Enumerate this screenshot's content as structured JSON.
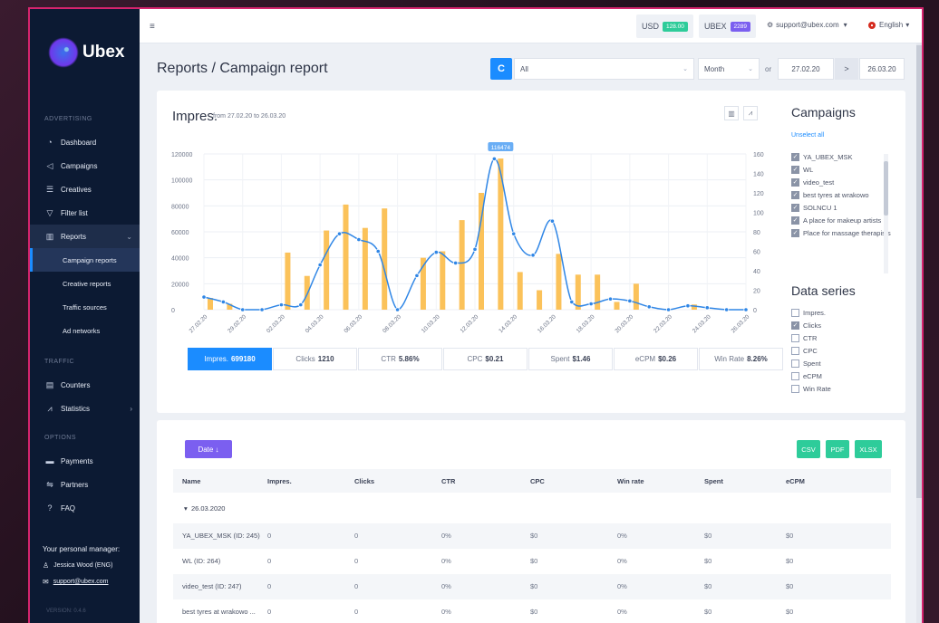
{
  "app": {
    "brand": "Ubex",
    "version": "VERSION: 0.4.6"
  },
  "sidebar": {
    "sections": [
      "ADVERTISING",
      "TRAFFIC",
      "OPTIONS"
    ],
    "items": [
      {
        "label": "Dashboard",
        "icon": "dashboard-icon"
      },
      {
        "label": "Campaigns",
        "icon": "megaphone-icon"
      },
      {
        "label": "Creatives",
        "icon": "list-icon"
      },
      {
        "label": "Filter list",
        "icon": "filter-icon"
      },
      {
        "label": "Reports",
        "icon": "bar-chart-icon"
      },
      {
        "label": "Counters",
        "icon": "counter-icon"
      },
      {
        "label": "Statistics",
        "icon": "line-chart-icon"
      },
      {
        "label": "Payments",
        "icon": "card-icon"
      },
      {
        "label": "Partners",
        "icon": "handshake-icon"
      },
      {
        "label": "FAQ",
        "icon": "help-icon"
      }
    ],
    "report_subitems": [
      "Campaign reports",
      "Creative reports",
      "Traffic sources",
      "Ad networks"
    ],
    "manager": {
      "title": "Your personal manager:",
      "name": "Jessica Wood (ENG)",
      "email": "support@ubex.com"
    }
  },
  "topbar": {
    "usd_label": "USD",
    "usd_value": "128.00",
    "ubex_label": "UBEX",
    "ubex_value": "2289",
    "account": "support@ubex.com",
    "language": "English",
    "colors": {
      "usd_badge": "#2ecc9a",
      "ubex_badge": "#7b5ff0",
      "primary": "#1b8cff"
    }
  },
  "header": {
    "title": "Reports / Campaign report",
    "refresh_label": "C",
    "campaign_filter": "All",
    "period": "Month",
    "or_label": "or",
    "date_from": "27.02.20",
    "date_sep": ">",
    "date_to": "26.03.20"
  },
  "chart_card": {
    "title": "Impres.",
    "subtitle": "from 27.02.20 to 26.03.20",
    "metrics": [
      {
        "label": "Impres.",
        "value": "699180"
      },
      {
        "label": "Clicks",
        "value": "1210"
      },
      {
        "label": "CTR",
        "value": "5.86%"
      },
      {
        "label": "CPC",
        "value": "$0.21"
      },
      {
        "label": "Spent",
        "value": "$1.46"
      },
      {
        "label": "eCPM",
        "value": "$0.26"
      },
      {
        "label": "Win Rate",
        "value": "8.26%"
      }
    ]
  },
  "chart_data": {
    "type": "bar",
    "categories": [
      "27.02.20",
      "28.02.20",
      "29.02.20",
      "01.03.20",
      "02.03.20",
      "03.03.20",
      "04.03.20",
      "05.03.20",
      "06.03.20",
      "07.03.20",
      "08.03.20",
      "09.03.20",
      "10.03.20",
      "11.03.20",
      "12.03.20",
      "13.03.20",
      "14.03.20",
      "15.03.20",
      "16.03.20",
      "17.03.20",
      "18.03.20",
      "19.03.20",
      "20.03.20",
      "21.03.20",
      "22.03.20",
      "23.03.20",
      "24.03.20",
      "25.03.20",
      "26.03.20"
    ],
    "x_tick_labels": [
      "27.02.20",
      "29.02.20",
      "02.03.20",
      "04.03.20",
      "06.03.20",
      "08.03.20",
      "10.03.20",
      "12.03.20",
      "14.03.20",
      "16.03.20",
      "18.03.20",
      "20.03.20",
      "22.03.20",
      "24.03.20",
      "26.03.20"
    ],
    "series": [
      {
        "name": "Impres.",
        "axis": "left",
        "color": "#fbc25a",
        "values": [
          9000,
          4500,
          0,
          0,
          44000,
          26000,
          61000,
          81000,
          63000,
          78000,
          0,
          40000,
          45000,
          69000,
          90000,
          116474,
          29000,
          15000,
          43000,
          27000,
          27000,
          6000,
          20000,
          0,
          0,
          4000,
          0,
          0,
          0
        ]
      },
      {
        "name": "Clicks",
        "axis": "right",
        "color": "#2f86e6",
        "values": [
          13,
          8,
          0,
          0,
          5,
          5,
          46,
          78,
          72,
          60,
          0,
          35,
          59,
          48,
          62,
          155,
          78,
          56,
          91,
          8,
          6,
          11,
          9,
          3,
          0,
          4,
          2,
          0,
          0
        ]
      }
    ],
    "ylim_left": [
      0,
      120000
    ],
    "yticks_left": [
      0,
      20000,
      40000,
      60000,
      80000,
      100000,
      120000
    ],
    "ylim_right": [
      0,
      160
    ],
    "yticks_right": [
      0,
      20,
      40,
      60,
      80,
      100,
      120,
      140,
      160
    ],
    "annotations": [
      {
        "category": "13.03.20",
        "label": "116474"
      }
    ],
    "grid": true
  },
  "campaigns": {
    "title": "Campaigns",
    "unselect_label": "Unselect all",
    "items": [
      "YA_UBEX_MSK",
      "WL",
      "video_test",
      "best tyres at wrakowo",
      "SOLNCU 1",
      "A place for makeup artists",
      "Place for massage therapists"
    ]
  },
  "data_series": {
    "title": "Data series",
    "items": [
      {
        "label": "Impres.",
        "checked": false
      },
      {
        "label": "Clicks",
        "checked": true
      },
      {
        "label": "CTR",
        "checked": false
      },
      {
        "label": "CPC",
        "checked": false
      },
      {
        "label": "Spent",
        "checked": false
      },
      {
        "label": "eCPM",
        "checked": false
      },
      {
        "label": "Win Rate",
        "checked": false
      }
    ]
  },
  "table": {
    "sort_label": "Date ↓",
    "exports": [
      "CSV",
      "PDF",
      "XLSX"
    ],
    "columns": [
      "Name",
      "Impres.",
      "Clicks",
      "CTR",
      "CPC",
      "Win rate",
      "Spent",
      "eCPM"
    ],
    "group": "26.03.2020",
    "rows": [
      [
        "YA_UBEX_MSK (ID: 245)",
        "0",
        "0",
        "0%",
        "$0",
        "0%",
        "$0",
        "$0"
      ],
      [
        "WL (ID: 264)",
        "0",
        "0",
        "0%",
        "$0",
        "0%",
        "$0",
        "$0"
      ],
      [
        "video_test (ID: 247)",
        "0",
        "0",
        "0%",
        "$0",
        "0%",
        "$0",
        "$0"
      ],
      [
        "best tyres at wrakowo ...",
        "0",
        "0",
        "0%",
        "$0",
        "0%",
        "$0",
        "$0"
      ]
    ]
  }
}
